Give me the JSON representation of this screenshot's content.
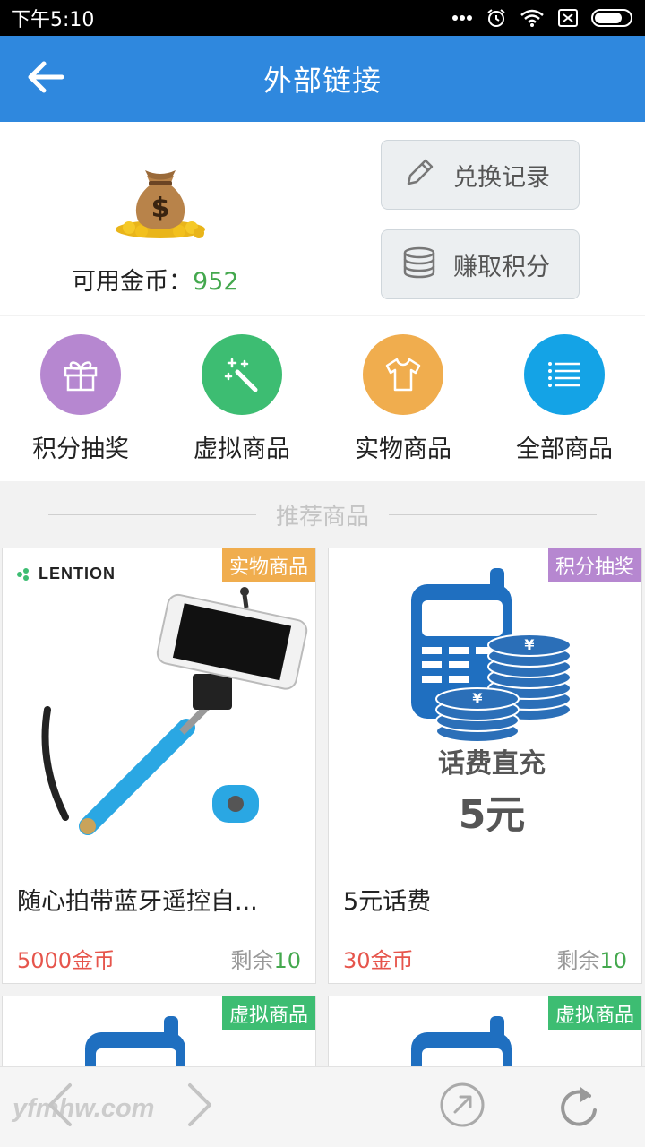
{
  "status_bar": {
    "time": "下午5:10",
    "icons": [
      "more-dots-icon",
      "alarm-icon",
      "wifi-icon",
      "sim-off-icon",
      "battery-icon"
    ]
  },
  "app_bar": {
    "title": "外部链接",
    "back_icon": "arrow-left-icon",
    "color": "#2f88de"
  },
  "coins": {
    "label": "可用金币：",
    "value": "952",
    "value_color": "#44a84e"
  },
  "actions": {
    "history_label": "兑换记录",
    "earn_label": "赚取积分"
  },
  "categories": [
    {
      "label": "积分抽奖",
      "icon": "gift-icon",
      "color": "#b687d0"
    },
    {
      "label": "虚拟商品",
      "icon": "magic-wand-icon",
      "color": "#3dbd72"
    },
    {
      "label": "实物商品",
      "icon": "tshirt-icon",
      "color": "#f0ad4e"
    },
    {
      "label": "全部商品",
      "icon": "list-icon",
      "color": "#14a3e6"
    }
  ],
  "recommended": {
    "title": "推荐商品"
  },
  "products": [
    {
      "tag": "实物商品",
      "tag_color": "#f0ad4e",
      "brand": "LENTION",
      "name": "随心拍带蓝牙遥控自...",
      "price": "5000金币",
      "stock_label": "剩余",
      "stock_value": "10"
    },
    {
      "tag": "积分抽奖",
      "tag_color": "#b687d0",
      "image_line1": "话费直充",
      "image_line2": "5元",
      "name": "5元话费",
      "price": "30金币",
      "stock_label": "剩余",
      "stock_value": "10"
    },
    {
      "tag": "虚拟商品",
      "tag_color": "#3dbd72"
    },
    {
      "tag": "虚拟商品",
      "tag_color": "#3dbd72"
    }
  ],
  "browser_bar": {
    "watermark": "yfmhw.com",
    "icons": [
      "back-chevron-icon",
      "forward-chevron-icon",
      "share-icon",
      "refresh-icon"
    ]
  }
}
